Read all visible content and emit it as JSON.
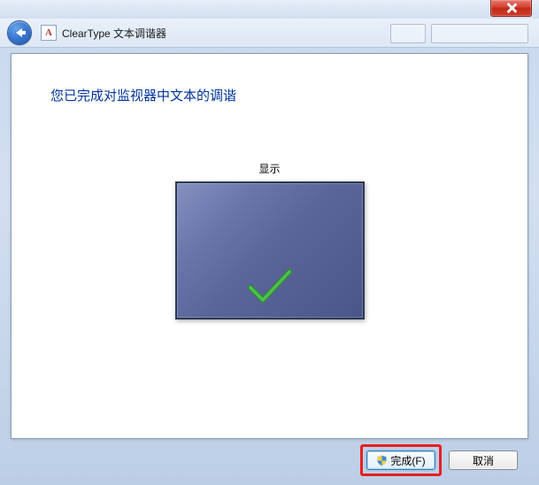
{
  "window": {
    "app_title": "ClearType 文本调谐器"
  },
  "main": {
    "heading": "您已完成对监视器中文本的调谐",
    "display_label": "显示"
  },
  "footer": {
    "finish_label": "完成(F)",
    "cancel_label": "取消"
  }
}
